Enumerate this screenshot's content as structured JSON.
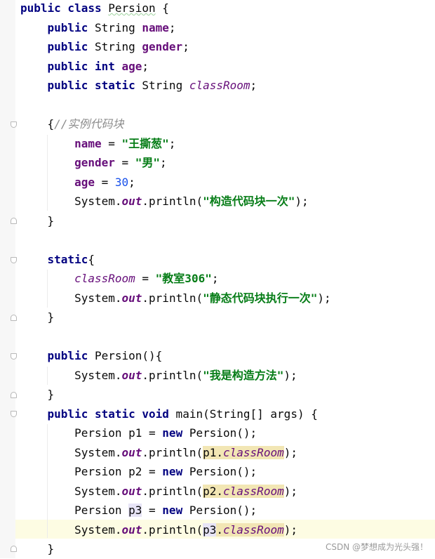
{
  "editor": {
    "lines": [
      [
        {
          "t": "public class ",
          "c": "kw"
        },
        {
          "t": "Persion",
          "c": "cls"
        },
        {
          "t": " {"
        }
      ],
      [
        {
          "t": "    "
        },
        {
          "t": "public",
          "c": "kw"
        },
        {
          "t": " String "
        },
        {
          "t": "name",
          "c": "field"
        },
        {
          "t": ";"
        }
      ],
      [
        {
          "t": "    "
        },
        {
          "t": "public",
          "c": "kw"
        },
        {
          "t": " String "
        },
        {
          "t": "gender",
          "c": "field"
        },
        {
          "t": ";"
        }
      ],
      [
        {
          "t": "    "
        },
        {
          "t": "public int",
          "c": "kw"
        },
        {
          "t": " "
        },
        {
          "t": "age",
          "c": "field"
        },
        {
          "t": ";"
        }
      ],
      [
        {
          "t": "    "
        },
        {
          "t": "public static",
          "c": "kw"
        },
        {
          "t": " String "
        },
        {
          "t": "classRoom",
          "c": "sfield"
        },
        {
          "t": ";"
        }
      ],
      [],
      [
        {
          "t": "    {"
        },
        {
          "t": "//实例代码块",
          "c": "cmt"
        }
      ],
      [
        {
          "t": "        "
        },
        {
          "t": "name",
          "c": "field"
        },
        {
          "t": " = "
        },
        {
          "t": "\"王撕葱\"",
          "c": "str"
        },
        {
          "t": ";"
        }
      ],
      [
        {
          "t": "        "
        },
        {
          "t": "gender",
          "c": "field"
        },
        {
          "t": " = "
        },
        {
          "t": "\"男\"",
          "c": "str"
        },
        {
          "t": ";"
        }
      ],
      [
        {
          "t": "        "
        },
        {
          "t": "age",
          "c": "field"
        },
        {
          "t": " = "
        },
        {
          "t": "30",
          "c": "num"
        },
        {
          "t": ";"
        }
      ],
      [
        {
          "t": "        System."
        },
        {
          "t": "out",
          "c": "sout"
        },
        {
          "t": ".println("
        },
        {
          "t": "\"构造代码块一次\"",
          "c": "str"
        },
        {
          "t": ");"
        }
      ],
      [
        {
          "t": "    }"
        }
      ],
      [],
      [
        {
          "t": "    "
        },
        {
          "t": "static",
          "c": "kw"
        },
        {
          "t": "{"
        }
      ],
      [
        {
          "t": "        "
        },
        {
          "t": "classRoom",
          "c": "sfield"
        },
        {
          "t": " = "
        },
        {
          "t": "\"教室306\"",
          "c": "str"
        },
        {
          "t": ";"
        }
      ],
      [
        {
          "t": "        System."
        },
        {
          "t": "out",
          "c": "sout"
        },
        {
          "t": ".println("
        },
        {
          "t": "\"静态代码块执行一次\"",
          "c": "str"
        },
        {
          "t": ");"
        }
      ],
      [
        {
          "t": "    }"
        }
      ],
      [],
      [
        {
          "t": "    "
        },
        {
          "t": "public",
          "c": "kw"
        },
        {
          "t": " Persion(){"
        }
      ],
      [
        {
          "t": "        System."
        },
        {
          "t": "out",
          "c": "sout"
        },
        {
          "t": ".println("
        },
        {
          "t": "\"我是构造方法\"",
          "c": "str"
        },
        {
          "t": ");"
        }
      ],
      [
        {
          "t": "    }"
        }
      ],
      [
        {
          "t": "    "
        },
        {
          "t": "public static void",
          "c": "kw"
        },
        {
          "t": " main(String[] args) {"
        }
      ],
      [
        {
          "t": "        Persion p1 = "
        },
        {
          "t": "new",
          "c": "kw"
        },
        {
          "t": " Persion();"
        }
      ],
      [
        {
          "t": "        System."
        },
        {
          "t": "out",
          "c": "sout"
        },
        {
          "t": ".println("
        },
        {
          "t": "p1.",
          "c": "hl-var"
        },
        {
          "t": "classRoom",
          "c": "sfield hl-var"
        },
        {
          "t": ");"
        }
      ],
      [
        {
          "t": "        Persion p2 = "
        },
        {
          "t": "new",
          "c": "kw"
        },
        {
          "t": " Persion();"
        }
      ],
      [
        {
          "t": "        System."
        },
        {
          "t": "out",
          "c": "sout"
        },
        {
          "t": ".println("
        },
        {
          "t": "p2.",
          "c": "hl-var"
        },
        {
          "t": "classRoom",
          "c": "sfield hl-var"
        },
        {
          "t": ");"
        }
      ],
      [
        {
          "t": "        Persion "
        },
        {
          "t": "p3",
          "c": "hl-sel"
        },
        {
          "t": " = "
        },
        {
          "t": "new",
          "c": "kw"
        },
        {
          "t": " Persion();"
        }
      ],
      [
        {
          "t": "        System."
        },
        {
          "t": "out",
          "c": "sout"
        },
        {
          "t": ".println("
        },
        {
          "t": "p3",
          "c": "hl-sel"
        },
        {
          "t": ".",
          "c": "hl-var"
        },
        {
          "t": "classRoom",
          "c": "sfield hl-var"
        },
        {
          "t": ");"
        }
      ],
      [
        {
          "t": "    }"
        }
      ]
    ]
  },
  "watermark": "CSDN @梦想成为光头强！"
}
